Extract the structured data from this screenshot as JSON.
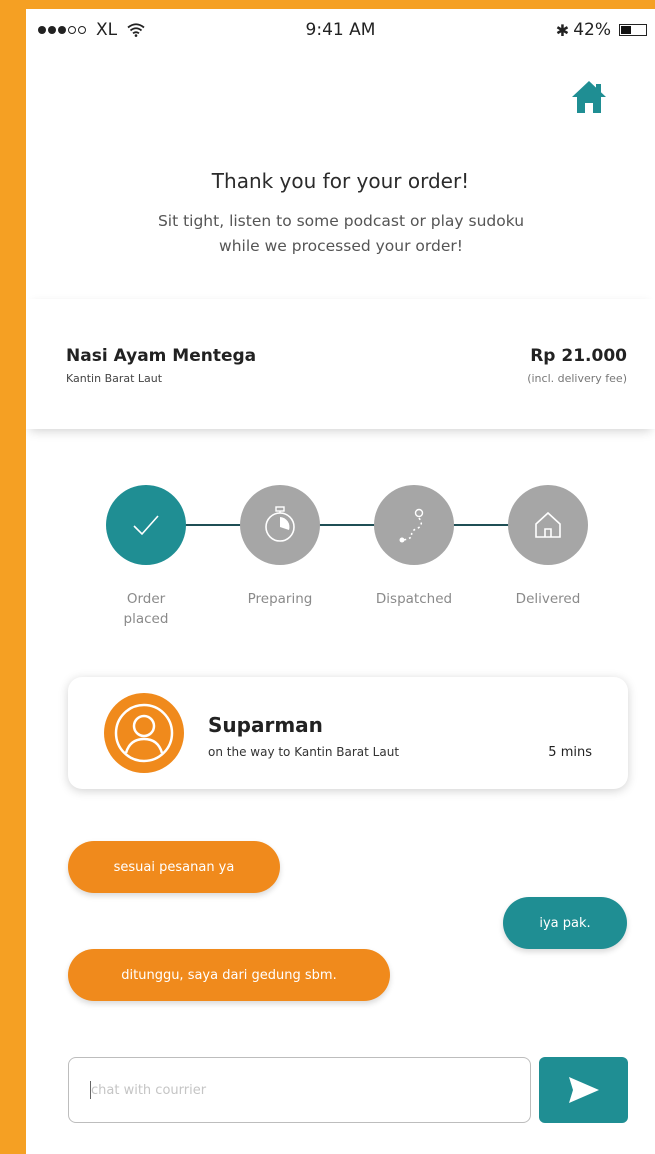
{
  "status_bar": {
    "signal_filled": 3,
    "signal_total": 5,
    "carrier": "XL",
    "wifi_icon": "wifi-icon",
    "time": "9:41 AM",
    "bluetooth_icon": "bluetooth-icon",
    "battery_percent": "42%",
    "battery_level": 0.42
  },
  "header": {
    "home_icon": "home-icon"
  },
  "message": {
    "title": "Thank you for your order!",
    "subtitle_line1": "Sit tight, listen to some podcast or play sudoku",
    "subtitle_line2": "while we processed your order!"
  },
  "order": {
    "item_name": "Nasi Ayam Mentega",
    "venue": "Kantin Barat Laut",
    "price": "Rp 21.000",
    "fee_note": "(incl. delivery fee)"
  },
  "tracker": {
    "steps": [
      {
        "label_line1": "Order",
        "label_line2": "placed",
        "icon": "check-icon",
        "state": "done"
      },
      {
        "label_line1": "Preparing",
        "label_line2": "",
        "icon": "stopwatch-icon",
        "state": "pending"
      },
      {
        "label_line1": "Dispatched",
        "label_line2": "",
        "icon": "route-icon",
        "state": "pending"
      },
      {
        "label_line1": "Delivered",
        "label_line2": "",
        "icon": "house-outline-icon",
        "state": "pending"
      }
    ],
    "done_color": "#1f8e93",
    "pending_color": "#a6a6a6"
  },
  "courier": {
    "avatar_icon": "user-avatar-icon",
    "name": "Suparman",
    "status": "on the way to Kantin Barat Laut",
    "eta": "5 mins"
  },
  "chat": {
    "messages": [
      {
        "from": "courier",
        "text": "sesuai pesanan ya"
      },
      {
        "from": "user",
        "text": "iya pak."
      },
      {
        "from": "courier",
        "text": "ditunggu, saya dari gedung sbm."
      }
    ],
    "input_placeholder": "chat with courrier",
    "send_icon": "send-icon"
  },
  "colors": {
    "accent_orange": "#f08a1c",
    "accent_teal": "#1f8e93",
    "background_orange": "#f5a023"
  }
}
